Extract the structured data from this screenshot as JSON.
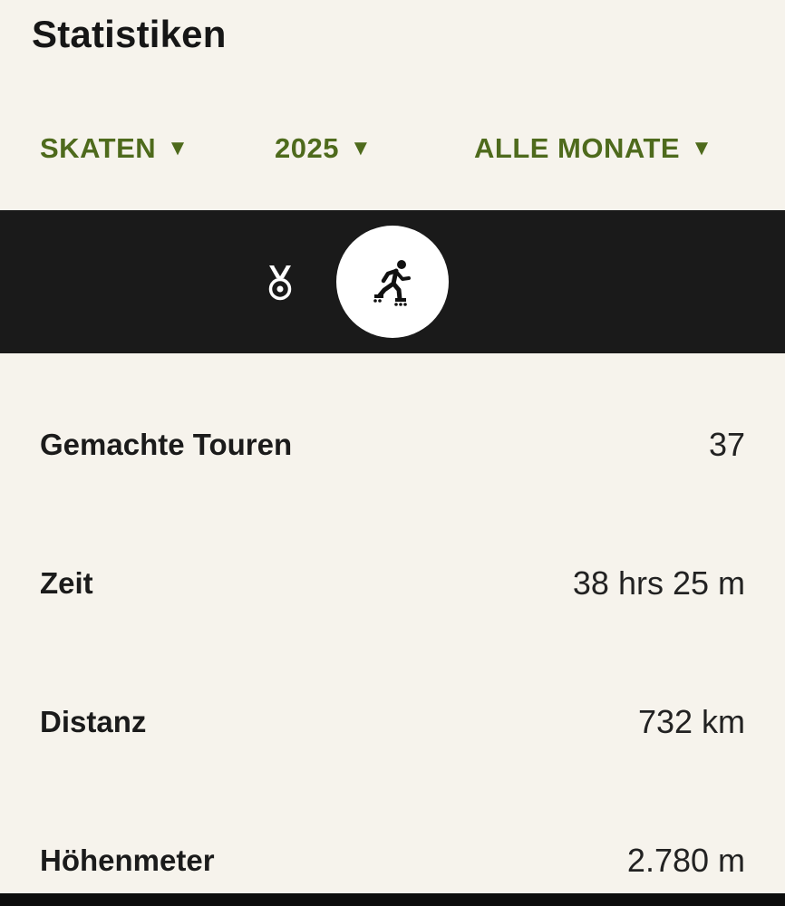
{
  "header": {
    "title": "Statistiken"
  },
  "filters": {
    "sport": "SKATEN",
    "year": "2025",
    "month": "ALLE MONATE",
    "caret": "▼"
  },
  "tabs": [
    {
      "icon": "medal-icon",
      "selected": false
    },
    {
      "icon": "inline-skater-icon",
      "selected": true
    }
  ],
  "stats": [
    {
      "label": "Gemachte Touren",
      "value": "37"
    },
    {
      "label": "Zeit",
      "value": "38 hrs 25 m"
    },
    {
      "label": "Distanz",
      "value": "732 km"
    },
    {
      "label": "Höhenmeter",
      "value": "2.780 m"
    }
  ],
  "colors": {
    "accent": "#4e6a1c",
    "background": "#f6f3ec",
    "band": "#1a1a1a"
  }
}
